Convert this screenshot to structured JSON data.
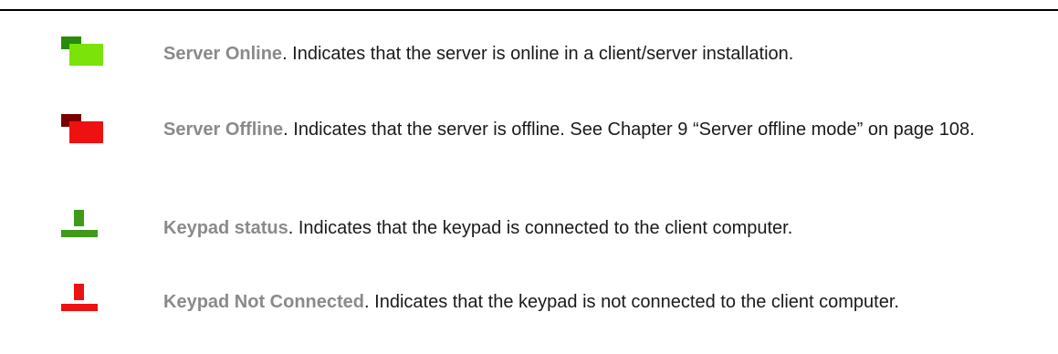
{
  "legend": [
    {
      "term": "Server Online",
      "description": ". Indicates that the server is online in a client/server installation.",
      "icon": "server-online-icon",
      "colors": {
        "back": "#2a8a0e",
        "front": "#7be20a"
      }
    },
    {
      "term": "Server Offline",
      "description": ". Indicates that the server is offline. See Chapter 9 “Server offline mode” on page 108.",
      "icon": "server-offline-icon",
      "colors": {
        "back": "#7a0000",
        "front": "#ee1111"
      }
    },
    {
      "term": "Keypad status",
      "description": ". Indicates that the keypad is connected to the client computer.",
      "icon": "keypad-connected-icon",
      "colors": {
        "post": "#3f9a18",
        "base": "#3f9a18"
      }
    },
    {
      "term": "Keypad Not Connected",
      "description": ". Indicates that the keypad is not connected to the client computer.",
      "icon": "keypad-disconnected-icon",
      "colors": {
        "post": "#ee1111",
        "base": "#ee1111"
      }
    }
  ]
}
